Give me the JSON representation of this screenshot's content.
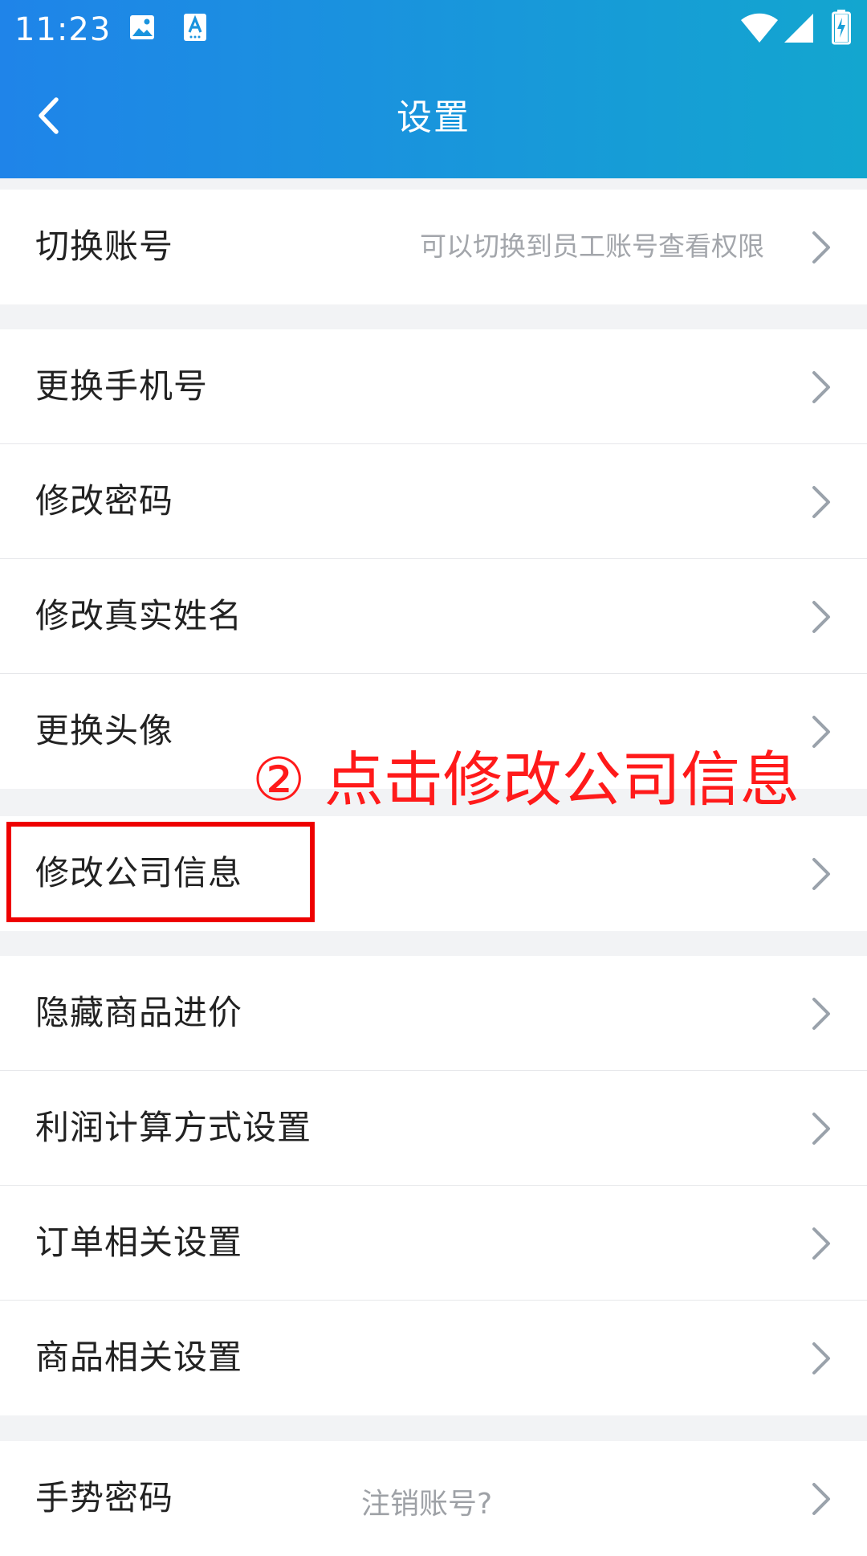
{
  "status_bar": {
    "time": "11:23",
    "icons": [
      "image-icon",
      "translate-icon",
      "wifi-icon",
      "signal-icon",
      "battery-charging-icon"
    ]
  },
  "nav": {
    "title": "设置",
    "back_icon": "chevron-left-icon"
  },
  "groups": [
    {
      "items": [
        {
          "label": "切换账号",
          "hint": "可以切换到员工账号查看权限"
        }
      ]
    },
    {
      "items": [
        {
          "label": "更换手机号"
        },
        {
          "label": "修改密码"
        },
        {
          "label": "修改真实姓名"
        },
        {
          "label": "更换头像"
        }
      ]
    },
    {
      "items": [
        {
          "label": "修改公司信息"
        }
      ]
    },
    {
      "items": [
        {
          "label": "隐藏商品进价"
        },
        {
          "label": "利润计算方式设置"
        },
        {
          "label": "订单相关设置"
        },
        {
          "label": "商品相关设置"
        }
      ]
    },
    {
      "items": [
        {
          "label": "手势密码"
        }
      ]
    }
  ],
  "footer": {
    "logout_link": "注销账号?"
  },
  "annotation": {
    "text": "② 点击修改公司信息",
    "color": "#ff1a1a"
  },
  "colors": {
    "header_start": "#1f84e9",
    "header_end": "#13a6cf",
    "background": "#f2f3f5",
    "chevron": "#9aa2ab"
  }
}
